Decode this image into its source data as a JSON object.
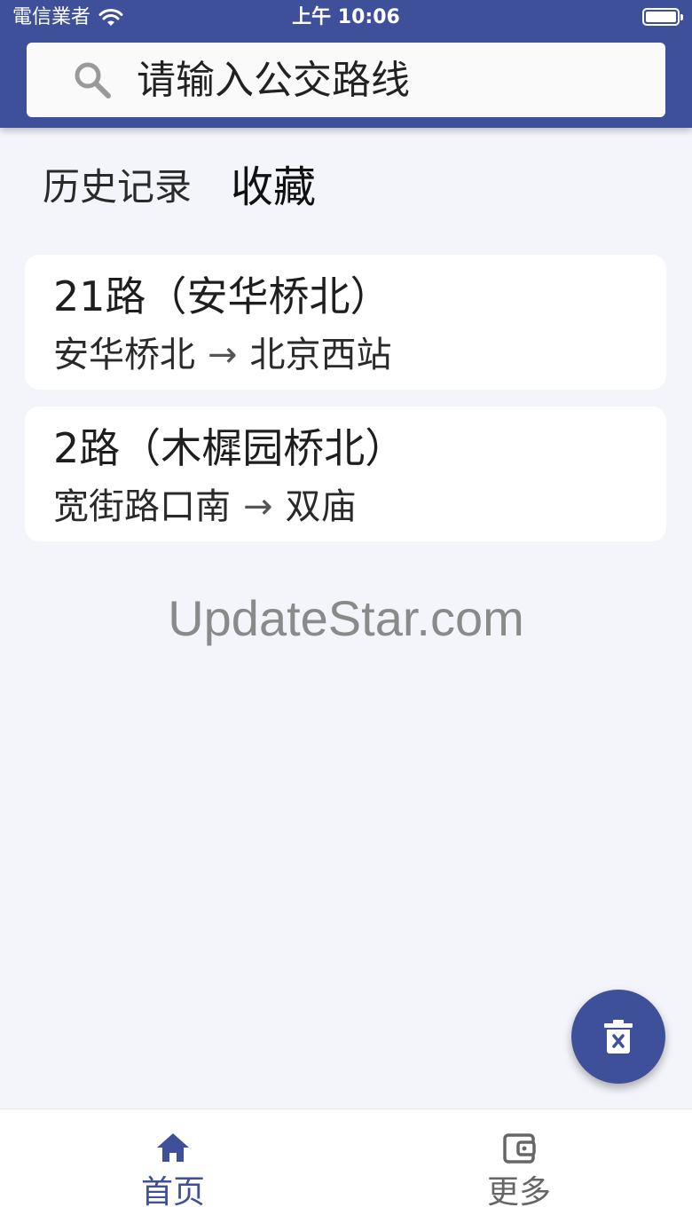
{
  "status_bar": {
    "carrier": "電信業者",
    "time": "上午 10:06"
  },
  "search": {
    "placeholder": "请输入公交路线",
    "icon": "search-icon"
  },
  "tabs": [
    {
      "label": "历史记录",
      "active": false
    },
    {
      "label": "收藏",
      "active": true
    }
  ],
  "routes": [
    {
      "title": "21路（安华桥北）",
      "from": "安华桥北",
      "arrow": "→",
      "to": "北京西站"
    },
    {
      "title": "2路（木樨园桥北）",
      "from": "宽街路口南",
      "arrow": "→",
      "to": "双庙"
    }
  ],
  "watermark": "UpdateStar.com",
  "fab": {
    "icon": "trash-icon"
  },
  "bottom_nav": [
    {
      "label": "首页",
      "icon": "home-icon",
      "active": true
    },
    {
      "label": "更多",
      "icon": "wallet-icon",
      "active": false
    }
  ],
  "colors": {
    "primary": "#3f509a",
    "background": "#f3f5fa",
    "card": "#ffffff",
    "inactive": "#666666"
  }
}
